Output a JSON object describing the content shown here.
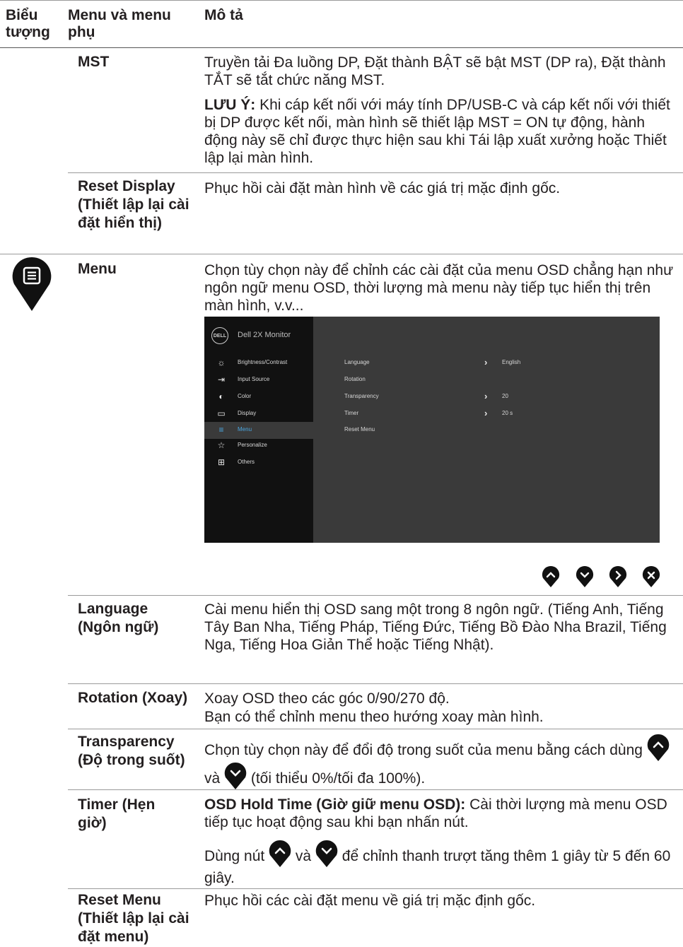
{
  "header": {
    "col_icon": "Biểu tượng",
    "col_menu": "Menu và menu phụ",
    "col_desc": "Mô tả"
  },
  "rows": {
    "mst": {
      "name": "MST",
      "desc1": "Truyền tải Đa luồng DP,  Đặt thành BẬT sẽ bật MST (DP ra), Đặt thành TẮT sẽ tắt chức năng MST.",
      "note_label": "LƯU Ý:",
      "note_text": " Khi cáp kết nối với máy tính DP/USB-C và cáp kết nối với thiết bị DP được kết nối, màn hình sẽ thiết lập MST = ON tự động, hành động này sẽ chỉ được thực hiện sau khi Tái lập xuất xưởng hoặc Thiết lập lại màn hình."
    },
    "reset_display": {
      "name": "Reset Display (Thiết lập lại cài đặt hiển thị)",
      "desc": "Phục hồi cài đặt màn hình về các giá trị mặc định gốc."
    },
    "menu": {
      "name": "Menu",
      "desc": "Chọn tùy chọn này để chỉnh các cài đặt của menu OSD chẳng hạn như ngôn ngữ menu OSD, thời lượng mà menu này tiếp tục hiển thị trên màn hình, v.v..."
    },
    "language": {
      "name": "Language (Ngôn ngữ)",
      "desc": "Cài menu hiển thị OSD sang một trong 8 ngôn ngữ. (Tiếng Anh, Tiếng Tây Ban Nha, Tiếng Pháp, Tiếng Đức, Tiếng Bồ Đào Nha Brazil, Tiếng Nga, Tiếng Hoa Giản Thể hoặc Tiếng Nhật)."
    },
    "rotation": {
      "name": "Rotation (Xoay)",
      "desc1": "Xoay OSD theo các góc 0/90/270 độ.",
      "desc2": "Bạn có thể chỉnh menu theo hướng xoay màn hình."
    },
    "transparency": {
      "name": "Transparency (Độ trong suốt)",
      "desc_a": "Chọn tùy chọn này để đổi độ trong suốt của menu bằng cách dùng ",
      "desc_b": " và ",
      "desc_c": " (tối thiểu 0%/tối đa 100%)."
    },
    "timer": {
      "name": "Timer (Hẹn giờ)",
      "bold": "OSD Hold Time (Giờ giữ menu OSD):",
      "desc1": " Cài thời lượng mà menu OSD tiếp tục hoạt động sau khi bạn nhấn nút.",
      "desc2_a": "Dùng nút ",
      "desc2_b": " và ",
      "desc2_c": " để chỉnh thanh trượt tăng thêm 1 giây từ 5 đến 60 giây."
    },
    "reset_menu": {
      "name": "Reset Menu (Thiết lập lại cài đặt menu)",
      "desc": "Phục hồi các cài đặt menu về giá trị mặc định gốc."
    }
  },
  "osd": {
    "logo": "DELL",
    "title": "Dell 2X Monitor",
    "menu_items": [
      "Brightness/Contrast",
      "Input Source",
      "Color",
      "Display",
      "Menu",
      "Personalize",
      "Others"
    ],
    "settings": [
      {
        "label": "Language",
        "value": "English",
        "arrow": true
      },
      {
        "label": "Rotation",
        "value": "",
        "arrow": false
      },
      {
        "label": "Transparency",
        "value": "20",
        "arrow": true
      },
      {
        "label": "Timer",
        "value": "20 s",
        "arrow": true
      },
      {
        "label": "Reset Menu",
        "value": "",
        "arrow": false
      }
    ]
  },
  "icons": [
    "menu-icon",
    "up-button-icon",
    "down-button-icon",
    "right-button-icon",
    "close-button-icon"
  ],
  "colors": {
    "accent": "#4aa6e0",
    "osd_bg": "#3a3a3a",
    "osd_sidebar": "#111111"
  }
}
